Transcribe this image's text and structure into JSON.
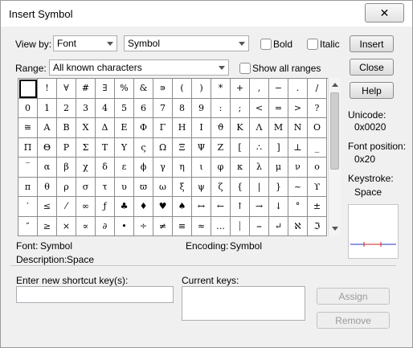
{
  "window": {
    "title": "Insert Symbol",
    "close_glyph": "✕"
  },
  "view_by": {
    "label": "View by:",
    "mode_value": "Font",
    "font_value": "Symbol"
  },
  "bold_label": "Bold",
  "italic_label": "Italic",
  "range": {
    "label": "Range:",
    "value": "All known characters",
    "show_all_label": "Show all ranges"
  },
  "buttons": {
    "insert": "Insert",
    "close": "Close",
    "help": "Help",
    "assign": "Assign",
    "remove": "Remove"
  },
  "info": {
    "unicode_label": "Unicode:",
    "unicode_value": "0x0020",
    "fontpos_label": "Font position:",
    "fontpos_value": "0x20",
    "keystroke_label": "Keystroke:",
    "keystroke_value": "Space"
  },
  "symbol_grid": [
    [
      " ",
      "!",
      "∀",
      "#",
      "∃",
      "%",
      "&",
      "∍",
      "(",
      ")",
      "*",
      "+",
      ",",
      "−",
      ".",
      "/"
    ],
    [
      "0",
      "1",
      "2",
      "3",
      "4",
      "5",
      "6",
      "7",
      "8",
      "9",
      ":",
      ";",
      "<",
      "=",
      ">",
      "?"
    ],
    [
      "≅",
      "Α",
      "Β",
      "Χ",
      "Δ",
      "Ε",
      "Φ",
      "Γ",
      "Η",
      "Ι",
      "ϑ",
      "Κ",
      "Λ",
      "Μ",
      "Ν",
      "Ο"
    ],
    [
      "Π",
      "Θ",
      "Ρ",
      "Σ",
      "Τ",
      "Υ",
      "ς",
      "Ω",
      "Ξ",
      "Ψ",
      "Ζ",
      "[",
      "∴",
      "]",
      "⊥",
      "_"
    ],
    [
      "‾",
      "α",
      "β",
      "χ",
      "δ",
      "ε",
      "ϕ",
      "γ",
      "η",
      "ι",
      "φ",
      "κ",
      "λ",
      "μ",
      "ν",
      "ο"
    ],
    [
      "π",
      "θ",
      "ρ",
      "σ",
      "τ",
      "υ",
      "ϖ",
      "ω",
      "ξ",
      "ψ",
      "ζ",
      "{",
      "|",
      "}",
      "~",
      "ϒ"
    ],
    [
      "′",
      "≤",
      "⁄",
      "∞",
      "ƒ",
      "♣",
      "♦",
      "♥",
      "♠",
      "↔",
      "←",
      "↑",
      "→",
      "↓",
      "°",
      "±"
    ],
    [
      "″",
      "≥",
      "×",
      "∝",
      "∂",
      "•",
      "÷",
      "≠",
      "≡",
      "≈",
      "…",
      "⏐",
      "⎯",
      "↵",
      "ℵ",
      "ℑ"
    ]
  ],
  "font_info": {
    "font_label": "Font:",
    "font_value": "Symbol",
    "desc_label": "Description:",
    "desc_value": "Space",
    "encoding_label": "Encoding:",
    "encoding_value": "Symbol"
  },
  "shortcut": {
    "new_key_label": "Enter new shortcut key(s):",
    "new_key_value": "",
    "current_keys_label": "Current keys:"
  }
}
